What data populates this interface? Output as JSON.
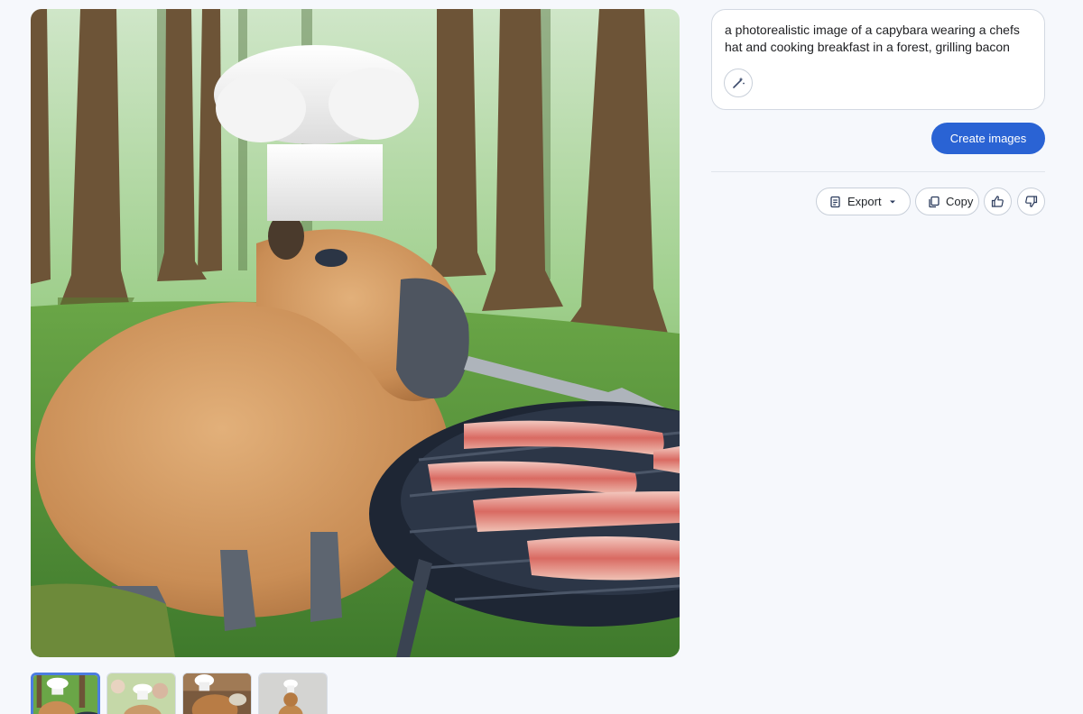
{
  "prompt": {
    "text": "a photorealistic image of a capybara wearing a chefs hat and cooking breakfast in a forest, grilling bacon",
    "magic_icon": "magic-wand-icon"
  },
  "create_button": {
    "label": "Create images",
    "color": "#2a63d4"
  },
  "actions": {
    "export_label": "Export",
    "copy_label": "Copy",
    "icons": [
      "export-icon",
      "chevron-down-icon",
      "copy-icon",
      "thumbs-up-icon",
      "thumbs-down-icon"
    ]
  },
  "thumbnails": {
    "count": 4,
    "selected_index": 0,
    "accent": "#4c7de0"
  }
}
